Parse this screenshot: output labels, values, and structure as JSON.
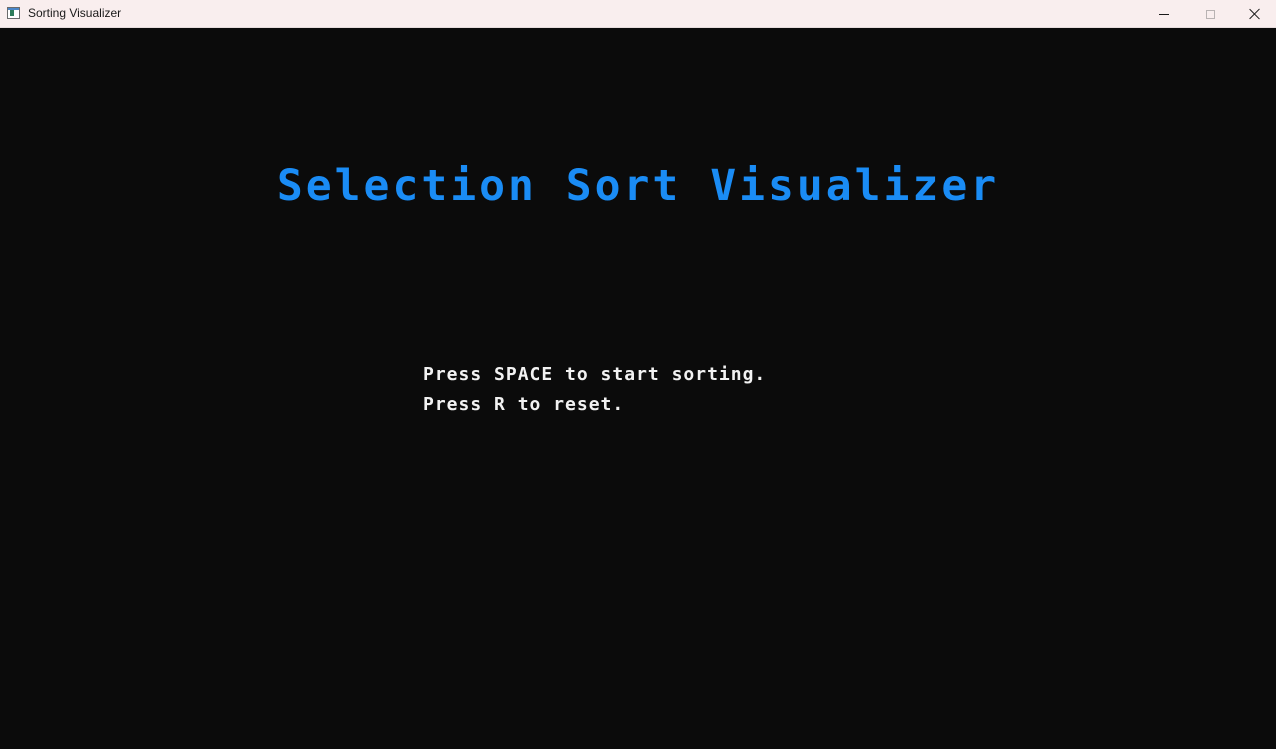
{
  "window": {
    "title": "Sorting Visualizer",
    "controls": {
      "minimize": "minimize-icon",
      "maximize": "maximize-icon",
      "close": "close-icon"
    }
  },
  "screen": {
    "heading": "Selection Sort Visualizer",
    "instructions": [
      "Press SPACE to start sorting.",
      "Press R to reset."
    ]
  },
  "colors": {
    "background": "#0b0b0b",
    "heading": "#1a8cf5",
    "text": "#f2f2f2",
    "titlebar": "#f9eeee"
  }
}
